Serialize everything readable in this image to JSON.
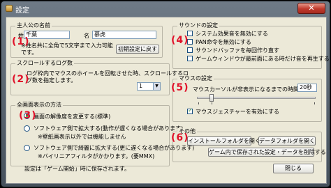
{
  "window": {
    "title": "設定",
    "close_glyph": "✕"
  },
  "name_group": {
    "legend": "主人公の名前",
    "marker": "(1)",
    "surname_value": "千葉",
    "given_label": "名",
    "given_value": "慕虎",
    "note_line1": "※姓名共に全角で5文字まで入力可能",
    "note_line2": "です。",
    "reset_button": "初期設定に戻す"
  },
  "scroll_group": {
    "legend": "スクロールするログ数",
    "marker": "(2)",
    "desc_line1": "ログ枠内でマウスのホイールを回転させた時、スクロールするロ",
    "desc_line2": "グ数を指定します。",
    "select_value": "1"
  },
  "fullscreen_group": {
    "legend": "全画面表示の方法",
    "marker": "(3)",
    "option1": "画面の解像度を変更する(標準)",
    "option2": "ソフトウェア側で拡大する(動作が遅くなる場合があります)",
    "option2_note": "※壁紙画表示以外では機能しません",
    "option3": "ソフトウェア側で綺麗に拡大する(更に遅くなる場合があります)",
    "option3_note": "※バイリニアフィルタがかかります。(要MMX)"
  },
  "sound_group": {
    "legend": "サウンドの設定",
    "marker": "(4)",
    "options": [
      {
        "label": "システム効果音を無効にする",
        "checked": false
      },
      {
        "label": "PAN命令を無効にする",
        "checked": false
      },
      {
        "label": "サウンドバッファを毎回作り直す",
        "checked": false
      },
      {
        "label": "ゲームウィンドウが最前面にある時だけ音を再生する",
        "checked": false
      }
    ]
  },
  "mouse_group": {
    "legend": "マウスの設定",
    "marker": "(5)",
    "hide_label": "マウスカーソルが非表示になるまでの時間",
    "hide_value": "20秒",
    "gesture_label": "マウスジェスチャーを有効にする",
    "gesture_checked": true
  },
  "other_group": {
    "legend": "その他",
    "marker": "(6)",
    "install_button": "インストールフォルダを開く",
    "data_button": "データフォルダを開く",
    "delete_button": "ゲーム内で保存された設定・データを削除する"
  },
  "footer": {
    "note": "設定は「ゲーム開始」時に保存されます。",
    "close_button": "閉じる"
  },
  "colors": {
    "accent_marker": "#e0122a",
    "face": "#ece9d8"
  }
}
